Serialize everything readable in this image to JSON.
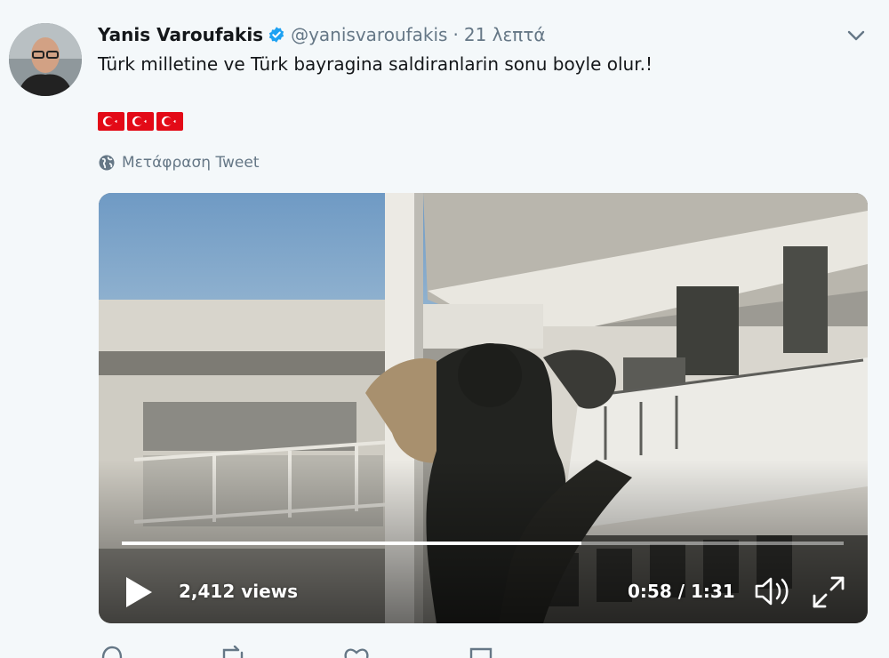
{
  "tweet": {
    "author_name": "Yanis Varoufakis",
    "handle": "@yanisvaroufakis",
    "separator": "·",
    "time": "21 λεπτά",
    "text": "Türk milletine ve Türk bayragina saldiranlarin sonu boyle olur.!",
    "flag_count": 3,
    "translate_label": "Μετάφραση Tweet"
  },
  "video": {
    "views": "2,412 views",
    "time_display": "0:58 / 1:31",
    "progress_fraction": 0.637
  },
  "icons": {
    "verified": "verified-badge-icon",
    "chevron": "chevron-down-icon",
    "globe": "globe-icon",
    "play": "play-icon",
    "volume": "volume-icon",
    "fullscreen": "fullscreen-icon",
    "reply": "reply-icon",
    "retweet": "retweet-icon",
    "like": "like-icon",
    "share": "share-icon"
  },
  "colors": {
    "background": "#f4f8fa",
    "verified_blue": "#1da1f2",
    "secondary_text": "#657786",
    "flag_red": "#e30a17"
  }
}
